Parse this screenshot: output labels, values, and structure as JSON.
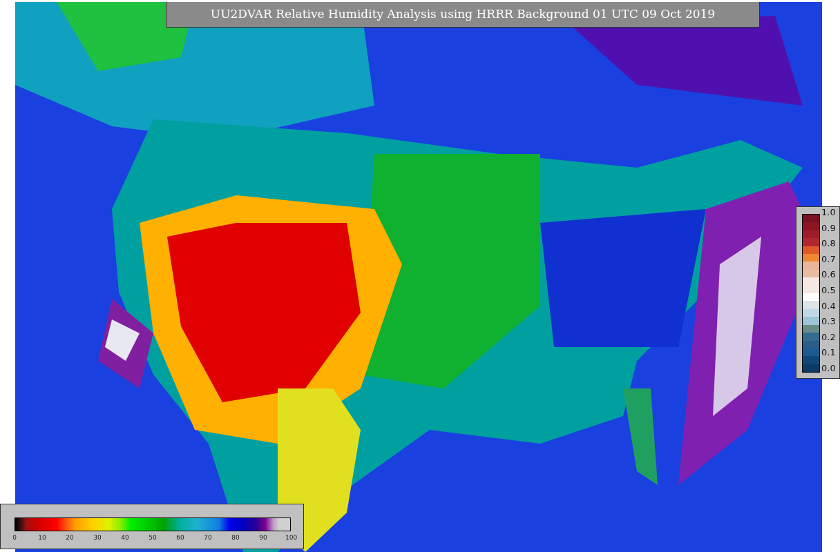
{
  "title": "UU2DVAR Relative Humidity Analysis using HRRR Background 01 UTC 09 Oct 2019",
  "horizontal_colorbar": {
    "ticks": [
      "0",
      "10",
      "20",
      "30",
      "40",
      "50",
      "60",
      "70",
      "80",
      "90",
      "100"
    ]
  },
  "vertical_colorbar": {
    "ticks": [
      "1.0",
      "0.9",
      "0.8",
      "0.7",
      "0.6",
      "0.5",
      "0.4",
      "0.3",
      "0.2",
      "0.1",
      "0.0"
    ]
  }
}
